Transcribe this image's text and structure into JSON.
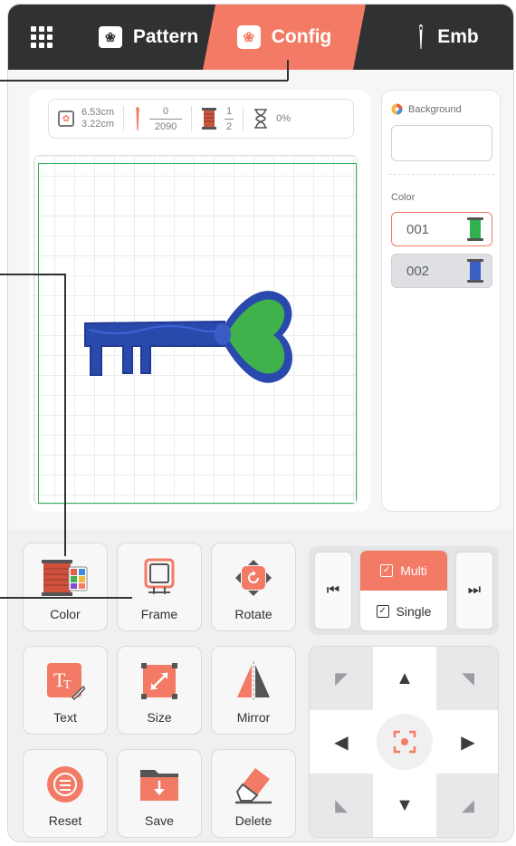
{
  "tabs": [
    {
      "label": "Pattern",
      "icon": "flower-card-icon"
    },
    {
      "label": "Config",
      "icon": "config-icon",
      "active": true
    },
    {
      "label": "Emb",
      "icon": "needle-icon"
    }
  ],
  "info": {
    "width": "6.53cm",
    "height": "3.22cm",
    "stitch_current": "0",
    "stitch_total": "2090",
    "color_current": "1",
    "color_total": "2",
    "progress": "0%"
  },
  "side": {
    "background_label": "Background",
    "color_label": "Color",
    "colors": [
      {
        "code": "001",
        "thread_color": "#2fb14f",
        "selected": true
      },
      {
        "code": "002",
        "thread_color": "#3a5fc5",
        "selected": false
      }
    ]
  },
  "tools": [
    {
      "label": "Color",
      "icon": "thread-palette-icon"
    },
    {
      "label": "Frame",
      "icon": "hoop-frame-icon"
    },
    {
      "label": "Rotate",
      "icon": "rotate-icon"
    },
    {
      "label": "Text",
      "icon": "text-icon"
    },
    {
      "label": "Size",
      "icon": "resize-icon"
    },
    {
      "label": "Mirror",
      "icon": "mirror-icon"
    },
    {
      "label": "Reset",
      "icon": "reset-icon"
    },
    {
      "label": "Save",
      "icon": "save-folder-icon"
    },
    {
      "label": "Delete",
      "icon": "eraser-icon"
    }
  ],
  "mode": {
    "multi": "Multi",
    "single": "Single",
    "active": "Multi"
  },
  "colors": {
    "accent": "#f37b66",
    "topbar": "#2f3133",
    "key_fill": "#3fb24b",
    "key_outline": "#2645a8"
  }
}
